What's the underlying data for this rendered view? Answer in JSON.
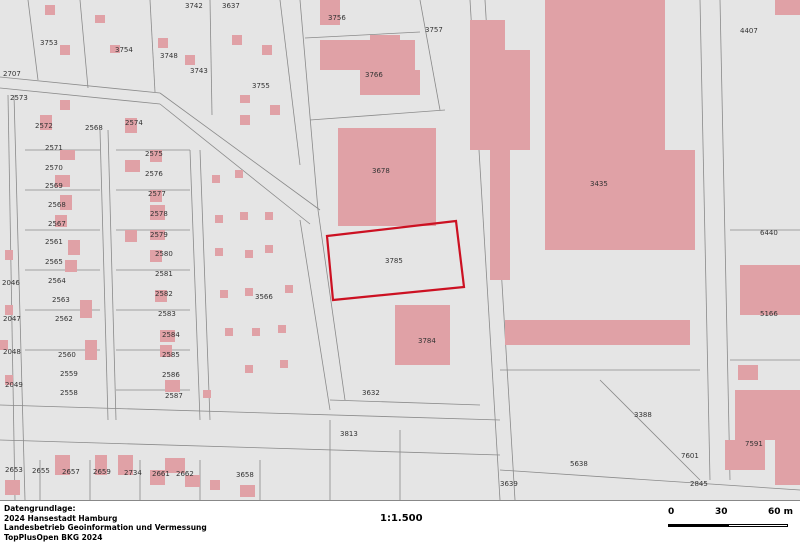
{
  "map": {
    "background_color": "#e5e5e5",
    "building_color": "#e0a1a6",
    "highlight_color": "#cc1122",
    "highlighted_parcel": "3785",
    "parcel_numbers": [
      "3753",
      "3754",
      "3748",
      "3742",
      "3637",
      "3743",
      "3755",
      "3756",
      "3757",
      "3766",
      "4407",
      "2707",
      "2573",
      "2572",
      "2568",
      "2574",
      "2571",
      "2570",
      "2575",
      "2576",
      "2569",
      "2577",
      "2568",
      "2578",
      "2567",
      "2579",
      "2561",
      "2580",
      "2565",
      "2581",
      "2564",
      "2582",
      "2563",
      "2583",
      "2562",
      "2584",
      "2560",
      "2585",
      "2559",
      "2586",
      "2558",
      "2587",
      "2046",
      "2047",
      "2048",
      "2049",
      "3566",
      "3678",
      "3785",
      "3784",
      "3435",
      "6440",
      "5166",
      "3632",
      "3813",
      "3388",
      "7591",
      "7601",
      "5638",
      "3639",
      "2845",
      "2653",
      "2655",
      "2657",
      "2659",
      "2734",
      "2661",
      "2662",
      "3658"
    ]
  },
  "footer": {
    "credits": [
      "Datengrundlage:",
      "2024 Hansestadt Hamburg",
      "Landesbetrieb Geoinformation und Vermessung",
      "TopPlusOpen BKG 2024"
    ],
    "scale": "1:1.500",
    "scalebar": {
      "start": "0",
      "mid": "30",
      "end": "60 m"
    }
  }
}
